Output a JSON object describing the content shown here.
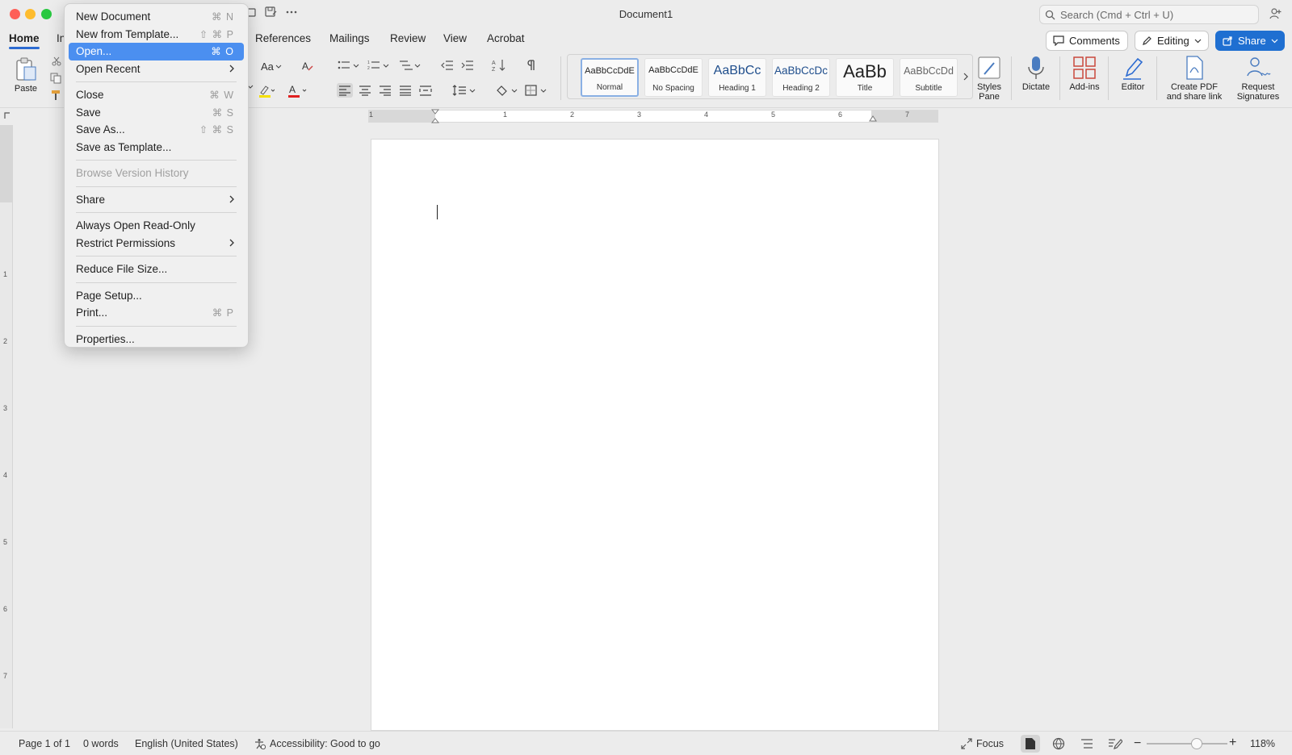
{
  "window": {
    "title": "Document1"
  },
  "search": {
    "placeholder": "Search (Cmd + Ctrl + U)"
  },
  "tabs": [
    {
      "label": "Home",
      "active": true
    },
    {
      "label": "In"
    },
    {
      "label": "References"
    },
    {
      "label": "Mailings"
    },
    {
      "label": "Review"
    },
    {
      "label": "View"
    },
    {
      "label": "Acrobat"
    }
  ],
  "header_buttons": {
    "comments": "Comments",
    "editing": "Editing",
    "share": "Share"
  },
  "ribbon": {
    "paste": "Paste",
    "font_case": "Aa",
    "styles": [
      {
        "preview": "AaBbCcDdE",
        "name": "Normal"
      },
      {
        "preview": "AaBbCcDdE",
        "name": "No Spacing"
      },
      {
        "preview": "AaBbCc",
        "name": "Heading 1"
      },
      {
        "preview": "AaBbCcDc",
        "name": "Heading 2"
      },
      {
        "preview": "AaBb",
        "name": "Title"
      },
      {
        "preview": "AaBbCcDd",
        "name": "Subtitle"
      }
    ],
    "styles_pane": "Styles Pane",
    "dictate": "Dictate",
    "addins": "Add-ins",
    "editor": "Editor",
    "create_pdf": "Create PDF and share link",
    "request_sign": "Request Signatures"
  },
  "ruler": {
    "numbers": [
      "1",
      "1",
      "2",
      "3",
      "4",
      "5",
      "6",
      "7"
    ]
  },
  "vruler": {
    "numbers": [
      "1",
      "2",
      "3",
      "4",
      "5",
      "6",
      "7"
    ]
  },
  "file_menu": {
    "items": [
      {
        "label": "New Document",
        "shortcut": "⌘ N"
      },
      {
        "label": "New from Template...",
        "shortcut": "⇧ ⌘ P"
      },
      {
        "label": "Open...",
        "shortcut": "⌘ O",
        "highlighted": true
      },
      {
        "label": "Open Recent",
        "submenu": true
      },
      {
        "sep": true
      },
      {
        "label": "Close",
        "shortcut": "⌘ W"
      },
      {
        "label": "Save",
        "shortcut": "⌘ S"
      },
      {
        "label": "Save As...",
        "shortcut": "⇧ ⌘ S"
      },
      {
        "label": "Save as Template..."
      },
      {
        "sep": true
      },
      {
        "label": "Browse Version History",
        "disabled": true
      },
      {
        "sep": true
      },
      {
        "label": "Share",
        "submenu": true
      },
      {
        "sep": true
      },
      {
        "label": "Always Open Read-Only"
      },
      {
        "label": "Restrict Permissions",
        "submenu": true
      },
      {
        "sep": true
      },
      {
        "label": "Reduce File Size..."
      },
      {
        "sep": true
      },
      {
        "label": "Page Setup..."
      },
      {
        "label": "Print...",
        "shortcut": "⌘ P"
      },
      {
        "sep": true
      },
      {
        "label": "Properties..."
      }
    ]
  },
  "status": {
    "page": "Page 1 of 1",
    "words": "0 words",
    "language": "English (United States)",
    "accessibility": "Accessibility: Good to go",
    "focus": "Focus",
    "zoom": "118%",
    "zoom_level": 0.62
  },
  "colors": {
    "accent": "#2c6bd1",
    "highlight": "#4b8ff0",
    "share": "#1f6fd1",
    "font_color": "#e02020",
    "highlighter": "#f5e100"
  }
}
